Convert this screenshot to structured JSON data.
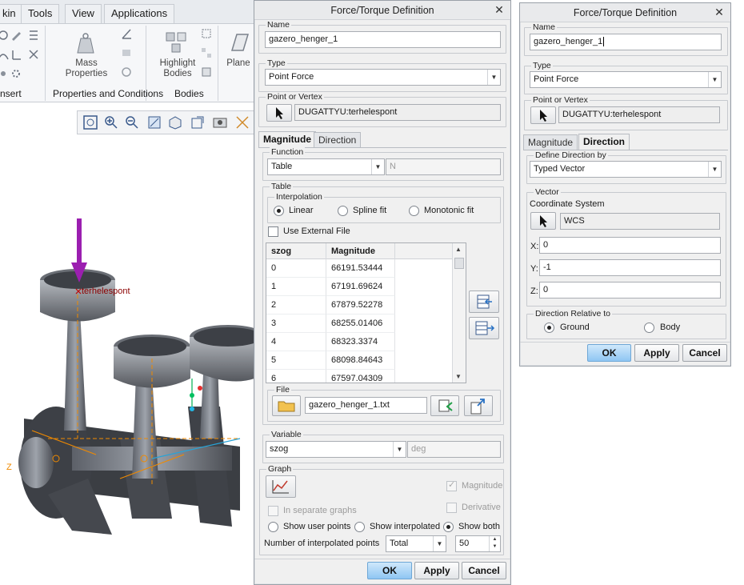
{
  "menu": {
    "tabs": [
      "kin",
      "Tools",
      "View",
      "Applications"
    ]
  },
  "ribbon": {
    "big_buttons": [
      {
        "label_1": "Mass",
        "label_2": "Properties"
      },
      {
        "label_1": "Highlight",
        "label_2": "Bodies"
      },
      {
        "label_1": "Plane",
        "label_2": ""
      }
    ],
    "groups": [
      "nsert",
      "Properties and Conditions",
      "Bodies"
    ]
  },
  "model": {
    "point_label": "terhelespont",
    "axis_label": "Z"
  },
  "dialog_left": {
    "title": "Force/Torque Definition",
    "name_label": "Name",
    "name_value": "gazero_henger_1",
    "type_label": "Type",
    "type_value": "Point Force",
    "point_label": "Point or Vertex",
    "point_value": "DUGATTYU:terhelespont",
    "tabs": [
      "Magnitude",
      "Direction"
    ],
    "function_label": "Function",
    "function_value": "Table",
    "function_unit": "N",
    "table_label": "Table",
    "interpolation_label": "Interpolation",
    "interp_options": [
      "Linear",
      "Spline fit",
      "Monotonic fit"
    ],
    "use_external_label": "Use External File",
    "columns": [
      "szog",
      "Magnitude"
    ],
    "rows": [
      [
        "0",
        "66191.53444"
      ],
      [
        "1",
        "67191.69624"
      ],
      [
        "2",
        "67879.52278"
      ],
      [
        "3",
        "68255.01406"
      ],
      [
        "4",
        "68323.3374"
      ],
      [
        "5",
        "68098.84643"
      ],
      [
        "6",
        "67597.04309"
      ]
    ],
    "file_label": "File",
    "file_value": "gazero_henger_1.txt",
    "variable_label": "Variable",
    "variable_value": "szog",
    "variable_unit": "deg",
    "graph_label": "Graph",
    "graph_magnitude": "Magnitude",
    "graph_separate": "In separate graphs",
    "graph_derivative": "Derivative",
    "show_options": [
      "Show user points",
      "Show interpolated",
      "Show both"
    ],
    "num_points_label": "Number of interpolated points",
    "num_points_mode": "Total",
    "num_points_value": "50",
    "ok": "OK",
    "apply": "Apply",
    "cancel": "Cancel"
  },
  "dialog_right": {
    "title": "Force/Torque Definition",
    "name_label": "Name",
    "name_value": "gazero_henger_1",
    "type_label": "Type",
    "type_value": "Point Force",
    "point_label": "Point or Vertex",
    "point_value": "DUGATTYU:terhelespont",
    "tabs": [
      "Magnitude",
      "Direction"
    ],
    "define_label": "Define Direction by",
    "define_value": "Typed Vector",
    "vector_label": "Vector",
    "coord_label": "Coordinate System",
    "coord_value": "WCS",
    "x_label": "X:",
    "x_value": "0",
    "y_label": "Y:",
    "y_value": "-1",
    "z_label": "Z:",
    "z_value": "0",
    "relative_label": "Direction Relative to",
    "relative_options": [
      "Ground",
      "Body"
    ],
    "ok": "OK",
    "apply": "Apply",
    "cancel": "Cancel"
  },
  "colors": {
    "accent": "#8fc6f3",
    "force_arrow": "#9b1fb0",
    "datum": "#f08a00"
  }
}
